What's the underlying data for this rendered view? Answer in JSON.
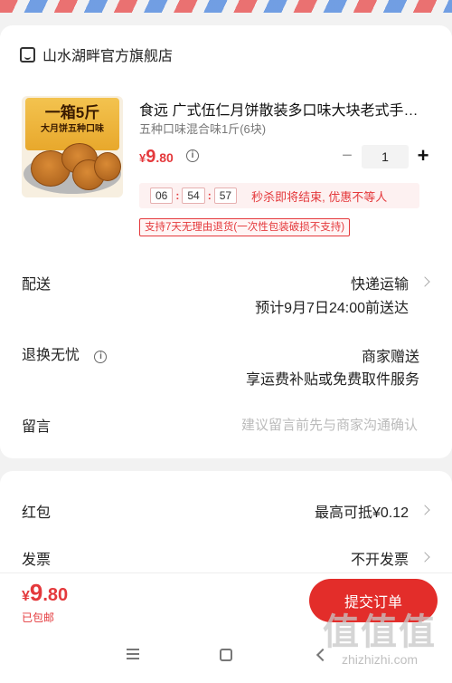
{
  "shop": {
    "name": "山水湖畔官方旗舰店",
    "icon": "shop-icon"
  },
  "product": {
    "image": {
      "box_title": "一箱5斤",
      "box_subtitle": "大月饼五种口味"
    },
    "title": "食远 广式伍仁月饼散装多口味大块老式手…",
    "variant": "五种口味混合味1斤(6块)",
    "price": {
      "currency": "¥",
      "integer": "9",
      "decimal": ".80"
    },
    "quantity": {
      "minus": "−",
      "value": "1",
      "plus": "+"
    },
    "countdown": {
      "hours": "06",
      "minutes": "54",
      "seconds": "57",
      "message": "秒杀即将结束, 优惠不等人"
    },
    "return_badge": "支持7天无理由退货(一次性包装破损不支持)"
  },
  "delivery": {
    "label": "配送",
    "method": "快递运输",
    "eta": "预计9月7日24:00前送达"
  },
  "returns": {
    "label": "退换无忧",
    "value": "商家赠送",
    "detail": "享运费补贴或免费取件服务"
  },
  "message": {
    "label": "留言",
    "placeholder": "建议留言前先与商家沟通确认"
  },
  "red_packet": {
    "label": "红包",
    "value": "最高可抵¥0.12"
  },
  "invoice": {
    "label": "发票",
    "value": "不开发票"
  },
  "footer": {
    "total": {
      "currency": "¥",
      "integer": "9",
      "decimal": ".80"
    },
    "shipping_note": "已包邮",
    "submit_label": "提交订单"
  },
  "watermark": {
    "logo": "值值值",
    "url": "zhizhizhi.com"
  },
  "colors": {
    "accent": "#e4393c",
    "button": "#e32d2a"
  }
}
